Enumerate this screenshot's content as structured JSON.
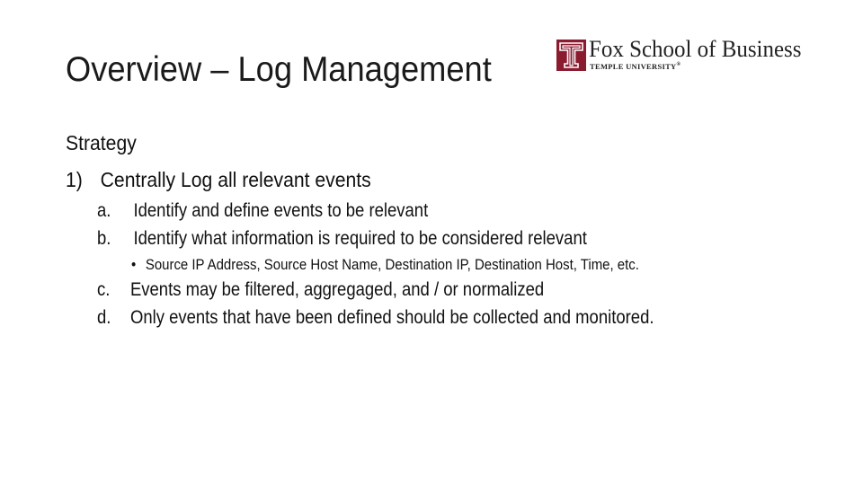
{
  "slide": {
    "title": "Overview – Log Management",
    "logo": {
      "icon": "temple-t-icon",
      "name": "Fox School of Business",
      "subtitle": "TEMPLE UNIVERSITY",
      "registered_mark": "®",
      "brand_color": "#8b1c30"
    },
    "heading": "Strategy",
    "point": {
      "number": "1)",
      "text": "Centrally Log all relevant events"
    },
    "subpoints": [
      {
        "letter": "a.",
        "text": "Identify and define events to be relevant"
      },
      {
        "letter": "b.",
        "text": "Identify what information is required to be considered relevant"
      },
      {
        "letter": "c.",
        "text": "Events may be filtered, aggregaged, and / or normalized"
      },
      {
        "letter": "d.",
        "text": "Only events that have been defined should be collected and monitored."
      }
    ],
    "bullet": {
      "symbol": "•",
      "text": "Source IP Address, Source Host Name, Destination IP, Destination Host, Time, etc."
    }
  }
}
